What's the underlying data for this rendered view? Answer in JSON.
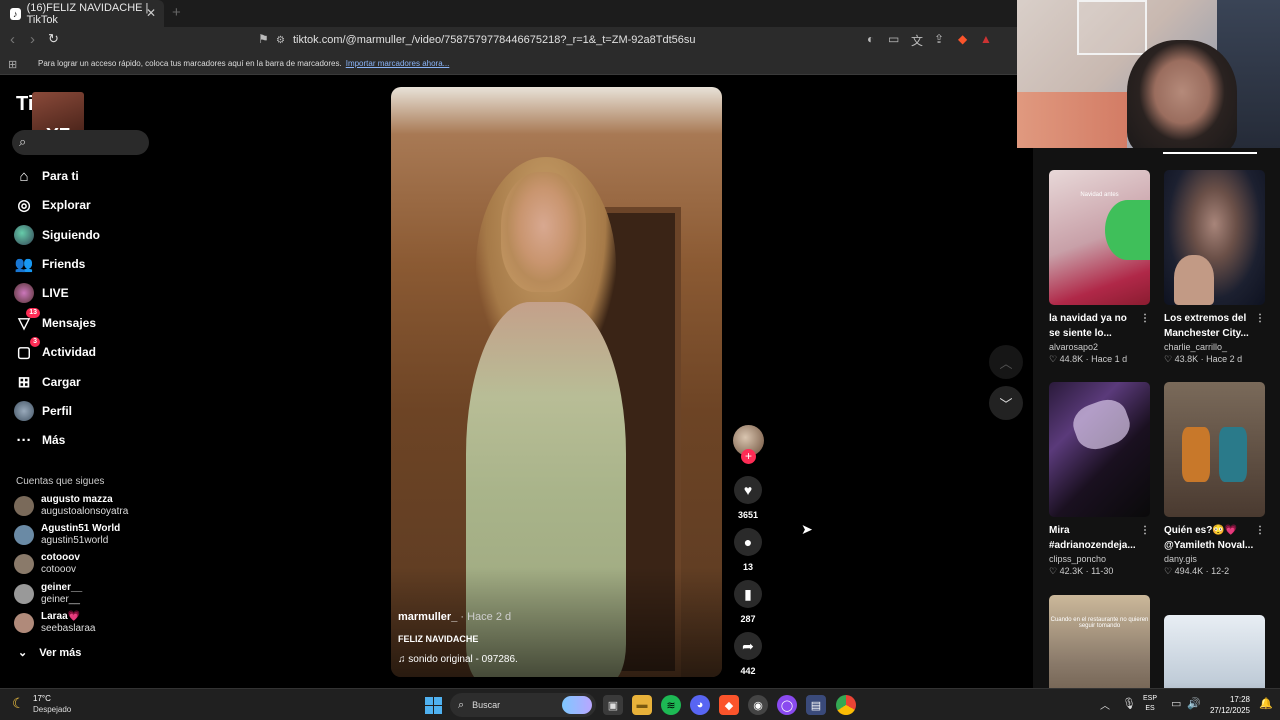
{
  "browser": {
    "tab_title": "(16)FELIZ NAVIDACHE | TikTok",
    "tab_close": "✕",
    "new_tab": "+",
    "url": "tiktok.com/@marmuller_/video/7587579778446675218?_r=1&_t=ZM-92a8Tdt56su",
    "bookmarks_hint": "Para lograr un acceso rápido, coloca tus marcadores aquí en la barra de marcadores.",
    "bookmarks_link": "Importar marcadores ahora..."
  },
  "sidebar": {
    "logo_text": "TikTok",
    "logo_overlay_text": "X7",
    "nav": [
      {
        "label": "Para ti",
        "icon": "home-icon"
      },
      {
        "label": "Explorar",
        "icon": "compass-icon"
      },
      {
        "label": "Siguiendo",
        "icon": "following-avatar-icon"
      },
      {
        "label": "Friends",
        "icon": "friends-icon"
      },
      {
        "label": "LIVE",
        "icon": "live-icon"
      },
      {
        "label": "Mensajes",
        "icon": "messages-icon",
        "badge": "13"
      },
      {
        "label": "Actividad",
        "icon": "activity-icon",
        "badge": "3"
      },
      {
        "label": "Cargar",
        "icon": "upload-icon"
      },
      {
        "label": "Perfil",
        "icon": "profile-avatar-icon"
      },
      {
        "label": "Más",
        "icon": "more-icon"
      }
    ],
    "following_title": "Cuentas que sigues",
    "following": [
      {
        "name": "augusto mazza",
        "handle": "augustoalonsoyatra"
      },
      {
        "name": "Agustin51 World",
        "handle": "agustin51world"
      },
      {
        "name": "cotooov",
        "handle": "cotooov"
      },
      {
        "name": "geiner__",
        "handle": "geiner__"
      },
      {
        "name": "Laraa💗",
        "handle": "seebaslaraa"
      }
    ],
    "see_more": "Ver más"
  },
  "video": {
    "username": "marmuller_",
    "time": " · Hace 2 d",
    "description": "FELIZ NAVIDACHE",
    "sound": "sonido original - 097286."
  },
  "actions": {
    "likes": "3651",
    "comments": "13",
    "saves": "287",
    "shares": "442"
  },
  "recommendations": [
    {
      "title": "la navidad ya no se siente lo...",
      "user": "alvarosapo2",
      "stats": "♡ 44.8K · Hace 1 d",
      "tag": "Navidad antes"
    },
    {
      "title": "Los extremos del Manchester City...",
      "user": "charlie_carrillo_",
      "stats": "♡ 43.8K · Hace 2 d",
      "tag": ""
    },
    {
      "title": "Mira #adrianozendeja...",
      "user": "clipss_poncho",
      "stats": "♡ 42.3K · 11-30",
      "tag": ""
    },
    {
      "title": "Quién es?😳💗 @Yamileth Noval...",
      "user": "dany.gis",
      "stats": "♡ 494.4K · 12-2",
      "tag": ""
    },
    {
      "title": "",
      "user": "",
      "stats": "",
      "tag": "Cuando en el restaurante no quieren seguir tomando"
    },
    {
      "title": "",
      "user": "",
      "stats": "",
      "tag": ""
    }
  ],
  "taskbar": {
    "temp": "17°C",
    "weather": "Despejado",
    "search_placeholder": "Buscar",
    "lang_top": "ESP",
    "lang_bottom": "ES",
    "time": "17:28",
    "date": "27/12/2025"
  },
  "colors": {
    "accent": "#fe2c55",
    "background": "#000000",
    "panel": "#121212"
  }
}
